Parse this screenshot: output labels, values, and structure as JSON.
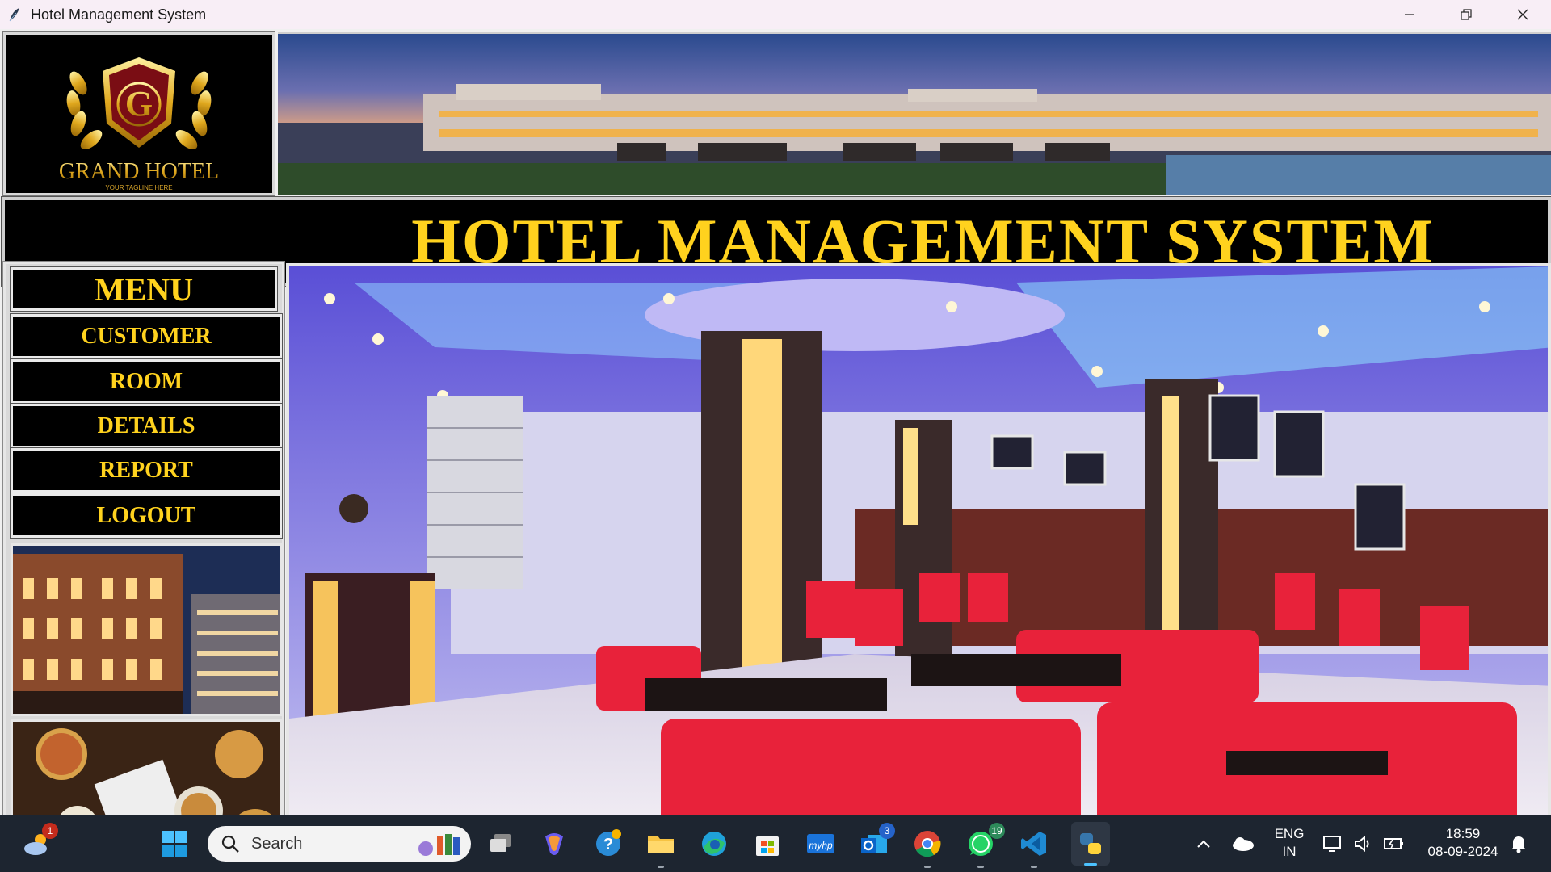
{
  "window": {
    "title": "Hotel Management System"
  },
  "logo": {
    "brand": "GRAND HOTEL",
    "tagline": "YOUR TAGLINE HERE",
    "initial": "G"
  },
  "heading": "HOTEL MANAGEMENT SYSTEM",
  "menu": {
    "title": "MENU",
    "items": [
      "CUSTOMER",
      "ROOM",
      "DETAILS",
      "REPORT",
      "LOGOUT"
    ]
  },
  "colors": {
    "accent_yellow": "#ffd21e",
    "panel_black": "#000000",
    "taskbar": "#1d2530"
  },
  "taskbar": {
    "search_placeholder": "Search",
    "weather_badge": "1",
    "outlook_badge": "3",
    "whatsapp_badge": "19",
    "language": "ENG",
    "region": "IN",
    "time": "18:59",
    "date": "08-09-2024",
    "icons": [
      "weather-icon",
      "windows-start-icon",
      "task-view-icon",
      "copilot-icon",
      "help-icon",
      "file-explorer-icon",
      "edge-icon",
      "store-icon",
      "myhp-icon",
      "outlook-icon",
      "chrome-icon",
      "whatsapp-icon",
      "vscode-icon",
      "python-icon"
    ]
  }
}
